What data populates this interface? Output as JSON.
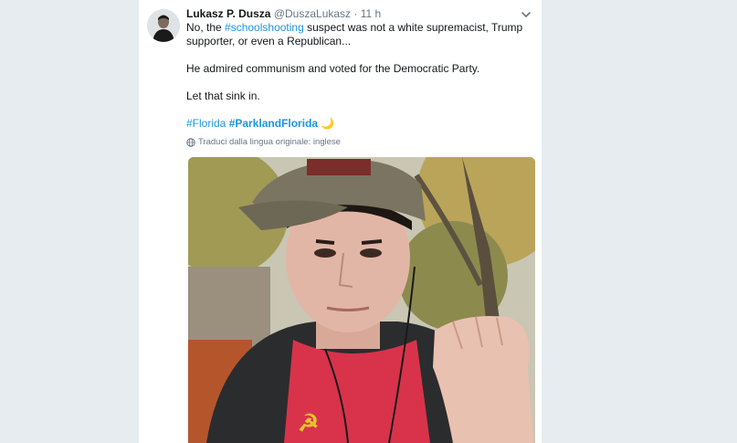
{
  "tweet": {
    "author_name": "Lukasz P. Dusza",
    "handle": "@DuszaLukasz",
    "separator": "·",
    "time": "11 h",
    "line1_a": "No, the ",
    "line1_hashtag": "#schoolshooting",
    "line1_b": " suspect was not a white supremacist, Trump supporter, or even a Republican...",
    "para2": "He admired communism and voted for the Democratic Party.",
    "para3": "Let that sink in.",
    "hashtag1": "#Florida",
    "hashtag2": "#ParklandFlorida",
    "moon_emoji": "🌙",
    "translate_label": "Traduci dalla lingua originale: inglese"
  },
  "colors": {
    "background": "#e6ecf0",
    "card": "#ffffff",
    "link": "#1b95e0",
    "meta": "#657786",
    "text": "#14171a"
  },
  "icons": {
    "menu": "chevron-down-icon",
    "translate": "globe-icon"
  }
}
